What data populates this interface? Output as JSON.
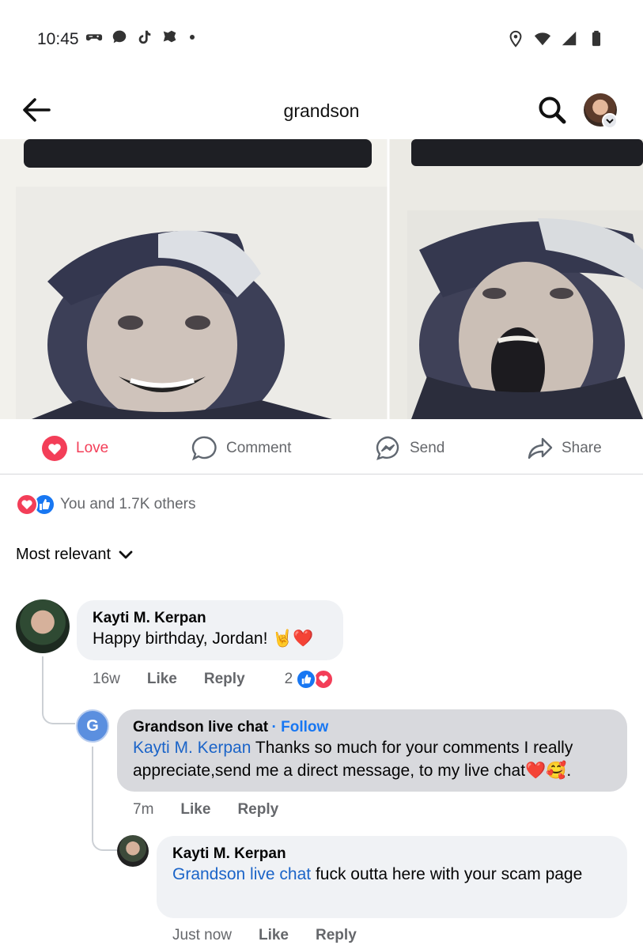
{
  "status": {
    "time": "10:45",
    "left_icons": [
      "game-controller-icon",
      "chat-bubble-icon",
      "tiktok-icon",
      "sports-app-icon"
    ],
    "right_icons": [
      "location-icon",
      "wifi-icon",
      "signal-icon",
      "battery-icon"
    ]
  },
  "header": {
    "title": "grandson"
  },
  "actions": [
    {
      "label": "Love",
      "icon": "heart-icon",
      "color": "#f33e58"
    },
    {
      "label": "Comment",
      "icon": "comment-icon"
    },
    {
      "label": "Send",
      "icon": "messenger-icon"
    },
    {
      "label": "Share",
      "icon": "share-icon"
    }
  ],
  "reactions": {
    "summary": "You and 1.7K others"
  },
  "sort": {
    "label": "Most relevant"
  },
  "comments": [
    {
      "author": "Kayti M. Kerpan",
      "text": "Happy birthday, Jordan! 🤘❤️",
      "time": "16w",
      "like": "Like",
      "reply": "Reply",
      "reaction_count": "2"
    },
    {
      "avatar_letter": "G",
      "author": "Grandson live chat",
      "follow": "· Follow",
      "mention": "Kayti M. Kerpan",
      "text": " Thanks so much for your comments I really appreciate,send me a direct message, to my live chat❤️🥰.",
      "time": "7m",
      "like": "Like",
      "reply": "Reply"
    },
    {
      "author": "Kayti M. Kerpan",
      "mention": "Grandson live chat",
      "text": "  fuck outta here with your scam page",
      "time": "Just now",
      "like": "Like",
      "reply": "Reply"
    }
  ],
  "colors": {
    "accent": "#1877f2",
    "love": "#f33e58",
    "muted": "#65676b"
  }
}
